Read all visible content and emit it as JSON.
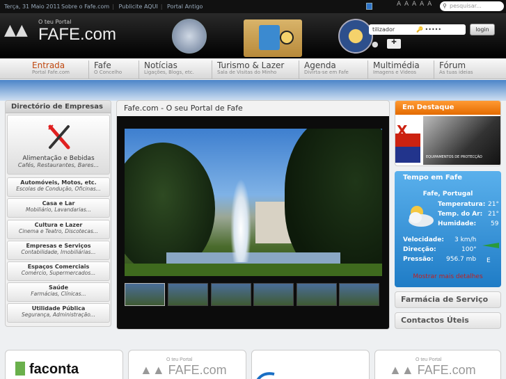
{
  "topbar": {
    "date": "Terça, 31 Maio 2011",
    "links": [
      "Sobre o Fafe.com",
      "Publicite AQUI",
      "Portal Antigo"
    ],
    "font_sizes": "A A A A A",
    "search_placeholder": "pesquisar..."
  },
  "header": {
    "logo_small": "O teu Portal",
    "logo_big": "FAFE.com",
    "login_user": "tilizador",
    "login_pass": "•••••",
    "login_button": "login"
  },
  "nav": [
    {
      "title": "Entrada",
      "sub": "Portal Fafe.com"
    },
    {
      "title": "Fafe",
      "sub": "O Concelho"
    },
    {
      "title": "Notícias",
      "sub": "Ligações, Blogs, etc."
    },
    {
      "title": "Turismo & Lazer",
      "sub": "Sala de Visitas do Minho"
    },
    {
      "title": "Agenda",
      "sub": "Divirta-se em Fafe"
    },
    {
      "title": "Multimédia",
      "sub": "Imagens e Videos"
    },
    {
      "title": "Fórum",
      "sub": "As tuas ideias"
    }
  ],
  "directory": {
    "title": "Directório de Empresas",
    "feature": {
      "name": "Alimentação e Bebidas",
      "desc": "Cafés, Restaurantes, Bares..."
    },
    "items": [
      {
        "name": "Automóveis, Motos, etc.",
        "desc": "Escolas de Condução, Oficinas..."
      },
      {
        "name": "Casa e Lar",
        "desc": "Mobiliário, Lavandarias..."
      },
      {
        "name": "Cultura e Lazer",
        "desc": "Cinema e Teatro, Discotecas..."
      },
      {
        "name": "Empresas e Serviços",
        "desc": "Contabilidade, Imobiliárias..."
      },
      {
        "name": "Espaços Comerciais",
        "desc": "Comércio, Supermercados..."
      },
      {
        "name": "Saúde",
        "desc": "Farmácias, Clínicas..."
      },
      {
        "name": "Utilidade Pública",
        "desc": "Segurança, Administração..."
      }
    ]
  },
  "center": {
    "title": "Fafe.com - O seu Portal de Fafe"
  },
  "destaque": {
    "title": "Em Destaque",
    "ad_text": "EQUIPAMENTOS DE PROTECÇÃO"
  },
  "weather": {
    "title": "Tempo em Fafe",
    "place": "Fafe, Portugal",
    "temperatura_label": "Temperatura:",
    "temperatura": "21°",
    "temp_ar_label": "Temp. do Ar:",
    "temp_ar": "21°",
    "humidade_label": "Humidade:",
    "humidade": "59",
    "velocidade_label": "Velocidade:",
    "velocidade": "3 km/h",
    "direccao_label": "Direcção:",
    "direccao": "100°",
    "pressao_label": "Pressão:",
    "pressao": "956.7 mb",
    "wind_dir": "E",
    "more": "Mostrar mais detalhes"
  },
  "boxes": {
    "farmacia": "Farmácia de Serviço",
    "contactos": "Contactos Úteis"
  },
  "bottom": {
    "faconta": "faconta",
    "logo1": "FAFE.com",
    "logo2": "FAFE.com",
    "logo_small": "O teu Portal"
  }
}
